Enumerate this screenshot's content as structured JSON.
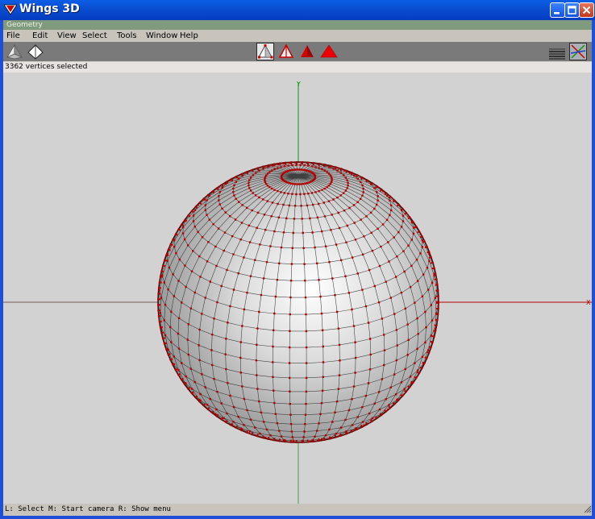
{
  "window": {
    "title": "Wings 3D",
    "minimize_icon": "minimize-icon",
    "maximize_icon": "maximize-icon",
    "close_icon": "close-icon"
  },
  "geometry_bar": {
    "label": "Geometry"
  },
  "menu": {
    "items": [
      "File",
      "Edit",
      "View",
      "Select",
      "Tools",
      "Window",
      "Help"
    ]
  },
  "toolbar": {
    "left": [
      "smooth-shaded-view-icon",
      "wireframe-view-icon"
    ],
    "modes": [
      "vertex-mode-icon",
      "edge-mode-icon",
      "face-mode-icon",
      "body-mode-icon"
    ],
    "active_mode": "vertex-mode-icon",
    "right": [
      "groundplane-toggle-icon",
      "axes-toggle-icon"
    ]
  },
  "info_line": "3362 vertices selected",
  "viewport": {
    "y_axis_label": "Y",
    "x_axis_label": "X",
    "colors": {
      "background": "#d2d2d2",
      "mesh_edge": "#2a2a2a",
      "selected_vertex": "#b40000",
      "x_axis": "#b40000",
      "y_axis": "#00a000"
    }
  },
  "status_bar": "L: Select  M: Start camera  R: Show menu"
}
